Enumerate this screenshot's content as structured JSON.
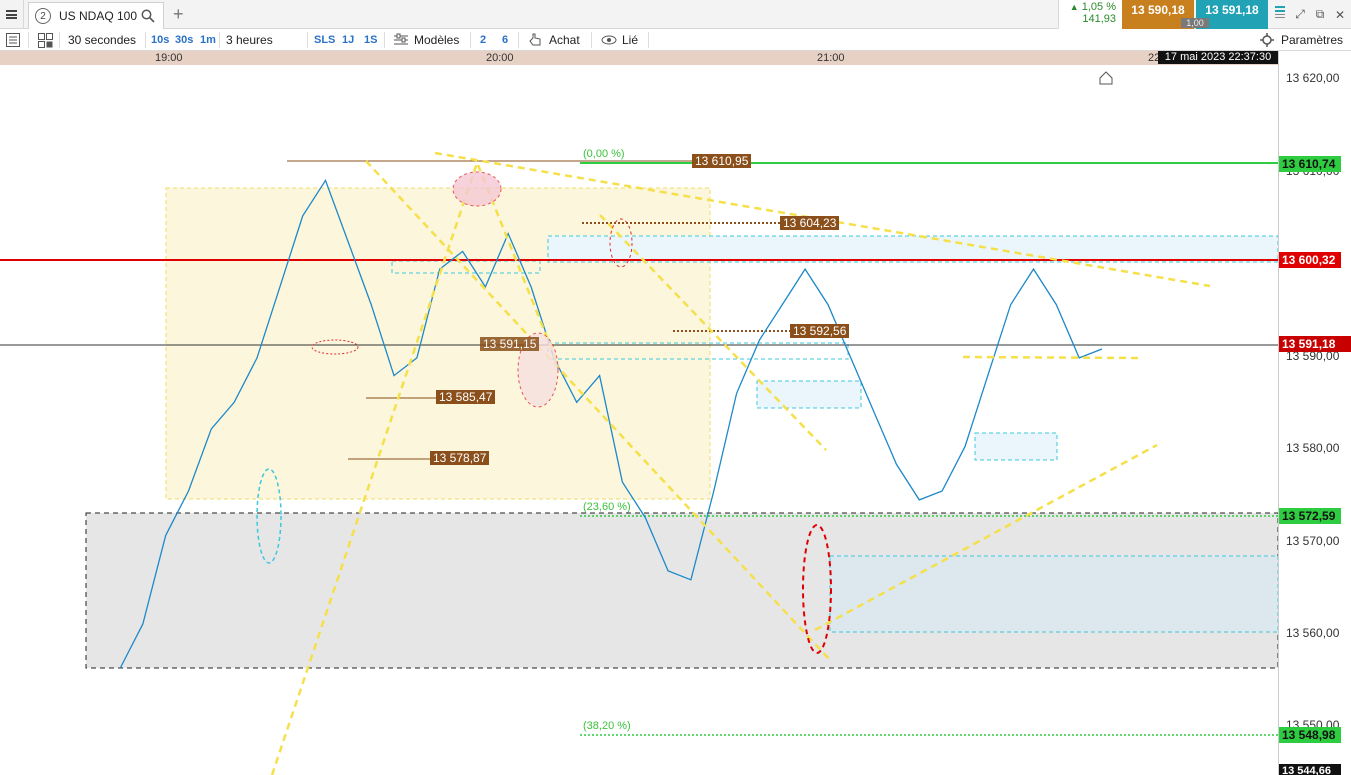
{
  "topbar": {
    "tab_number": "2",
    "tab_title": "US NDAQ 100",
    "change_pct": "1,05 %",
    "change_pts": "141,93",
    "bid": "13 590,18",
    "ask": "13 591,18",
    "spread": "1,00",
    "icons": [
      "menu-icon",
      "search-icon",
      "add-icon",
      "popout-icon",
      "external-icon",
      "close-icon"
    ]
  },
  "toolbar": {
    "interval": "30 secondes",
    "intervals": [
      "10s",
      "30s",
      "1m"
    ],
    "duration": "3 heures",
    "modes": [
      "SLS",
      "1J",
      "1S"
    ],
    "models": "Modèles",
    "counts": [
      "2",
      "6"
    ],
    "buy": "Achat",
    "linked": "Lié",
    "settings": "Paramètres"
  },
  "time_axis": {
    "ticks": [
      "19:00",
      "20:00",
      "21:00",
      "22"
    ],
    "datetime": "17 mai 2023 22:37:30"
  },
  "price_axis": {
    "ticks": [
      "13 620,00",
      "13 610,00",
      "13 590,00",
      "13 580,00",
      "13 570,00",
      "13 560,00",
      "13 550,00"
    ],
    "labels": {
      "fib0": "13 610,74",
      "red_line": "13 600,32",
      "current": "13 591,18",
      "fib236": "13 572,59",
      "fib382": "13 548,98",
      "bottom": "13 544,66"
    },
    "colors": {
      "green": "#2ecc40",
      "red": "#e00000",
      "current": "#c80000"
    }
  },
  "chart_annotations": {
    "fib0": "(0,00 %)",
    "fib236": "(23,60 %)",
    "fib382": "(38,20 %)",
    "level_610_95": "13 610,95",
    "level_604_23": "13 604,23",
    "level_592_56": "13 592,56",
    "level_591_15": "13 591,15",
    "level_585_47": "13 585,47",
    "level_578_87": "13 578,87"
  },
  "chart_data": {
    "type": "line",
    "title": "",
    "x": [
      "19:00",
      "20:00",
      "21:00"
    ],
    "ylim": [
      13543,
      13623
    ],
    "series": [
      {
        "values": [
          13555,
          13560,
          13570,
          13575,
          13582,
          13585,
          13590,
          13598,
          13606,
          13610,
          13603,
          13596,
          13588,
          13590,
          13600,
          13602,
          13598,
          13604,
          13598,
          13590,
          13585,
          13588,
          13576,
          13572,
          13566,
          13565,
          13575,
          13586,
          13592,
          13596,
          13600,
          13596,
          13590,
          13584,
          13578,
          13574,
          13575,
          13580,
          13588,
          13596,
          13600,
          13596,
          13590,
          13591
        ]
      }
    ],
    "grid": false
  }
}
